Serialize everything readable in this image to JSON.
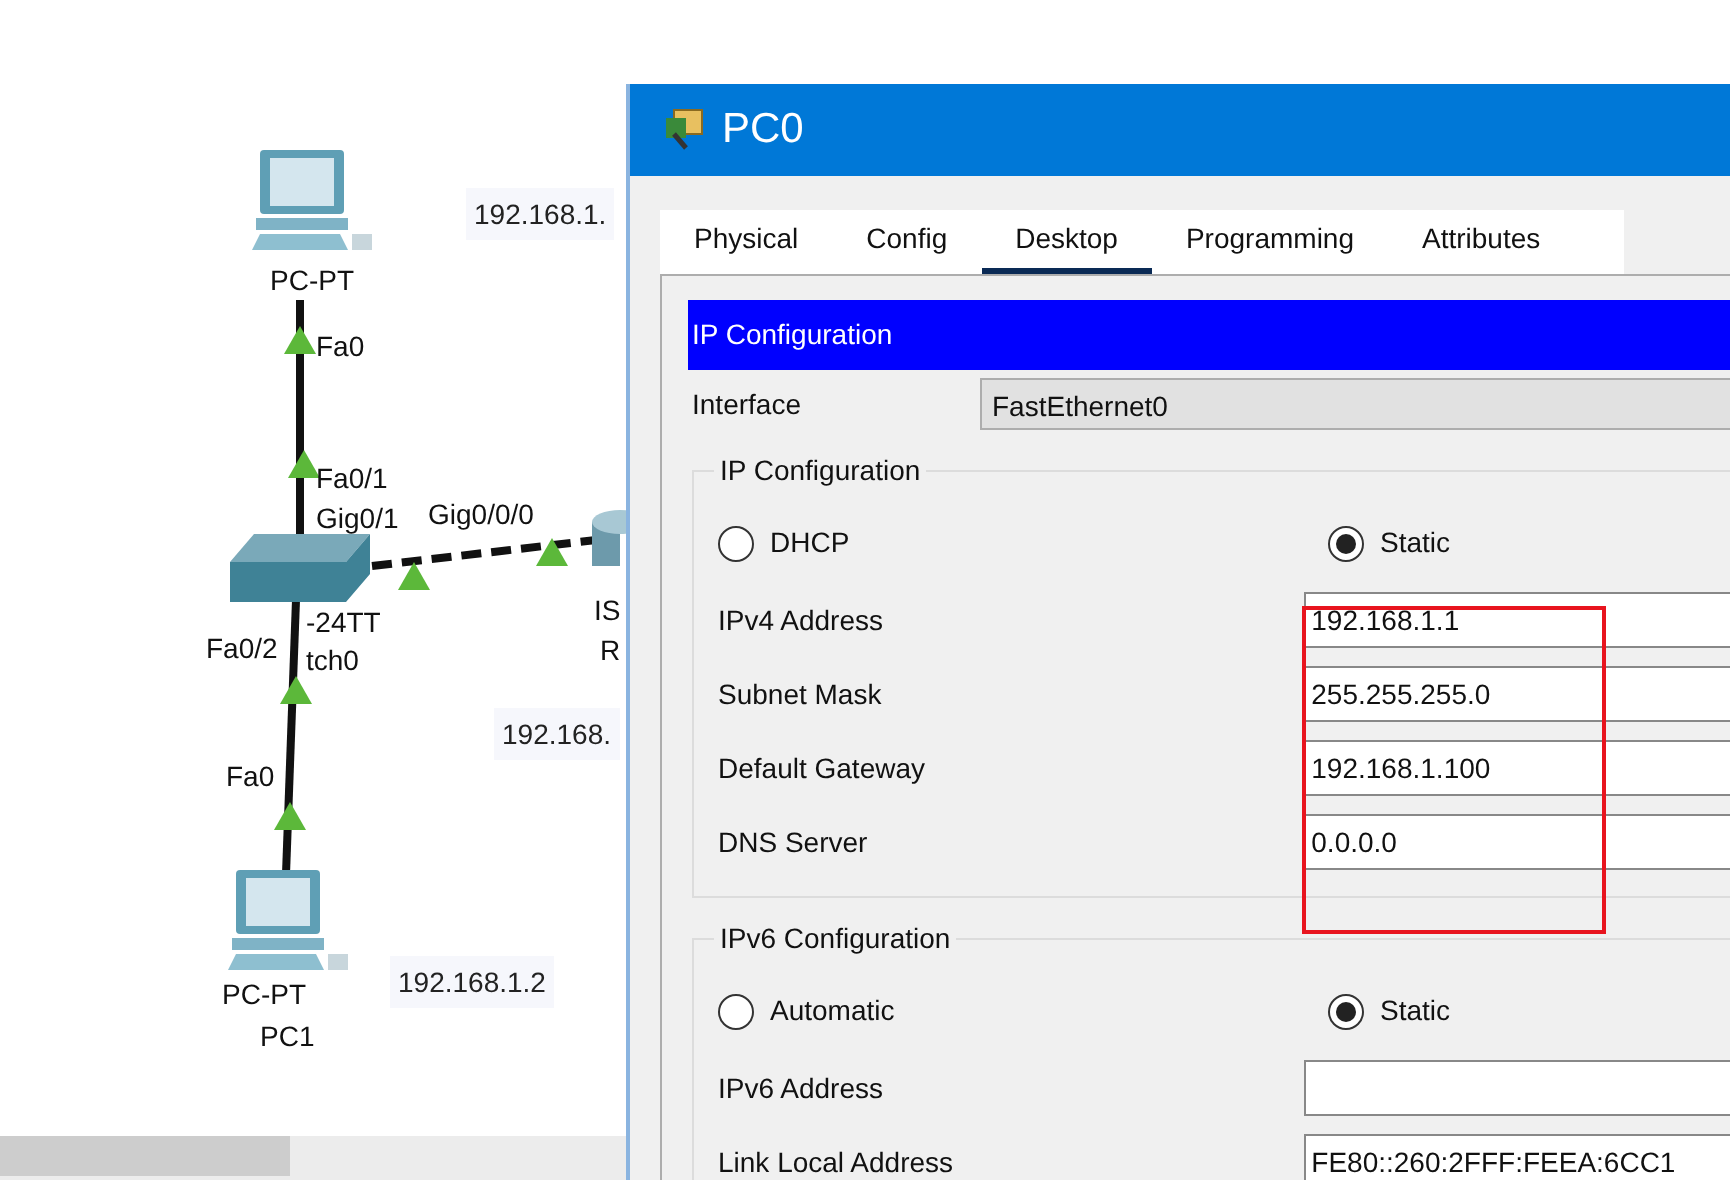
{
  "canvas": {
    "devices": [
      {
        "kind": "pc",
        "labels": [
          "PC-PT"
        ]
      },
      {
        "kind": "switch",
        "labels": [
          "-24TT",
          "tch0"
        ]
      },
      {
        "kind": "router",
        "labels": [
          "IS",
          "R"
        ]
      },
      {
        "kind": "pc",
        "labels": [
          "PC-PT",
          "PC1"
        ]
      }
    ],
    "links": [
      {
        "kind": "straight",
        "ports": [
          "Fa0",
          "Fa0/1"
        ]
      },
      {
        "kind": "crossover",
        "ports": [
          "Gig0/1",
          "Gig0/0/0"
        ]
      },
      {
        "kind": "straight",
        "ports": [
          "Fa0/2",
          "Fa0"
        ]
      }
    ],
    "ip_notes": [
      "192.168.1.",
      "192.168.",
      "192.168.1.2"
    ]
  },
  "window": {
    "title": "PC0",
    "tabs": [
      {
        "label": "Physical",
        "selected": false
      },
      {
        "label": "Config",
        "selected": false
      },
      {
        "label": "Desktop",
        "selected": true
      },
      {
        "label": "Programming",
        "selected": false
      },
      {
        "label": "Attributes",
        "selected": false
      }
    ],
    "section_header": "IP Configuration",
    "interface": {
      "label": "Interface",
      "value": "FastEthernet0"
    },
    "ipv4": {
      "legend": "IP Configuration",
      "modes": [
        {
          "label": "DHCP",
          "selected": false
        },
        {
          "label": "Static",
          "selected": true
        }
      ],
      "fields": [
        {
          "label": "IPv4 Address",
          "value": "192.168.1.1"
        },
        {
          "label": "Subnet Mask",
          "value": "255.255.255.0"
        },
        {
          "label": "Default Gateway",
          "value": "192.168.1.100"
        },
        {
          "label": "DNS Server",
          "value": "0.0.0.0"
        }
      ],
      "highlighted": true
    },
    "ipv6": {
      "legend": "IPv6 Configuration",
      "modes": [
        {
          "label": "Automatic",
          "selected": false
        },
        {
          "label": "Static",
          "selected": true
        }
      ],
      "fields": [
        {
          "label": "IPv6 Address"
        },
        {
          "label": "Link Local Address",
          "value": "FE80::260:2FFF:FEEA:6CC1"
        }
      ]
    }
  }
}
